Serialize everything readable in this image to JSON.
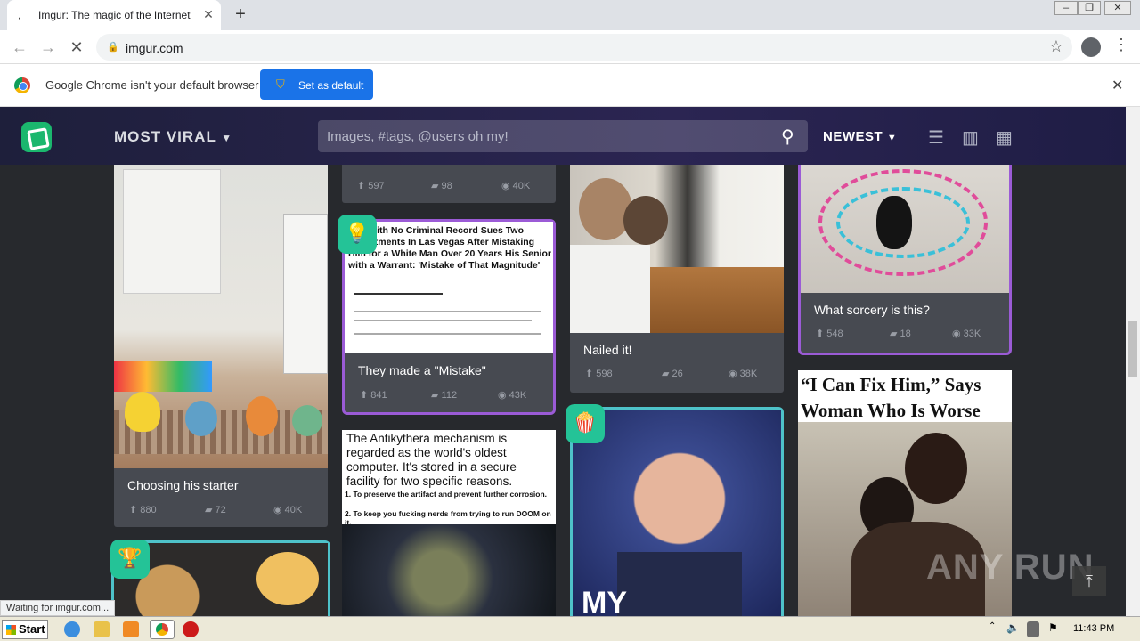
{
  "browser": {
    "tab_title": "Imgur: The magic of the Internet",
    "tab_favicon": ",",
    "url": "imgur.com",
    "infobar_text": "Google Chrome isn't your default browser",
    "set_default_label": "Set as default",
    "status_text": "Waiting for imgur.com..."
  },
  "header": {
    "section_label": "MOST VIRAL",
    "search_placeholder": "Images, #tags, @users oh my!",
    "sort_label": "NEWEST"
  },
  "posts": [
    {
      "caption": "Choosing his starter",
      "upvotes": "880",
      "comments": "72",
      "views": "40K"
    },
    {
      "caption": "",
      "upvotes": "597",
      "comments": "98",
      "views": "40K"
    },
    {
      "caption": "They made a \"Mistake\"",
      "upvotes": "841",
      "comments": "112",
      "views": "43K",
      "image_headline": "Man with No Criminal Record Sues Two Departments In Las Vegas After Mistaking Him for a White Man Over 20 Years His Senior with a Warrant: 'Mistake of That Magnitude'"
    },
    {
      "caption": "Nailed it!",
      "upvotes": "598",
      "comments": "26",
      "views": "38K"
    },
    {
      "caption": "What sorcery is this?",
      "upvotes": "548",
      "comments": "18",
      "views": "33K"
    },
    {
      "image_text": "The Antikythera mechanism is regarded as the world's oldest computer. It's stored in a secure facility for two specific reasons.",
      "image_point1": "1. To preserve the artifact and prevent further corrosion.",
      "image_point2": "2. To keep you fucking nerds from trying to run DOOM on it."
    },
    {
      "image_text": "MY"
    },
    {
      "image_text": "“I Can Fix Him,” Says Woman Who Is Worse"
    }
  ],
  "watermark": "ANY RUN",
  "taskbar": {
    "start_label": "Start",
    "clock": "11:43 PM"
  },
  "colors": {
    "imgur_green": "#1bb76e",
    "promoted_border": "#9b5bd6",
    "teal_border": "#4ec2c9",
    "chrome_blue": "#1a73e8"
  }
}
